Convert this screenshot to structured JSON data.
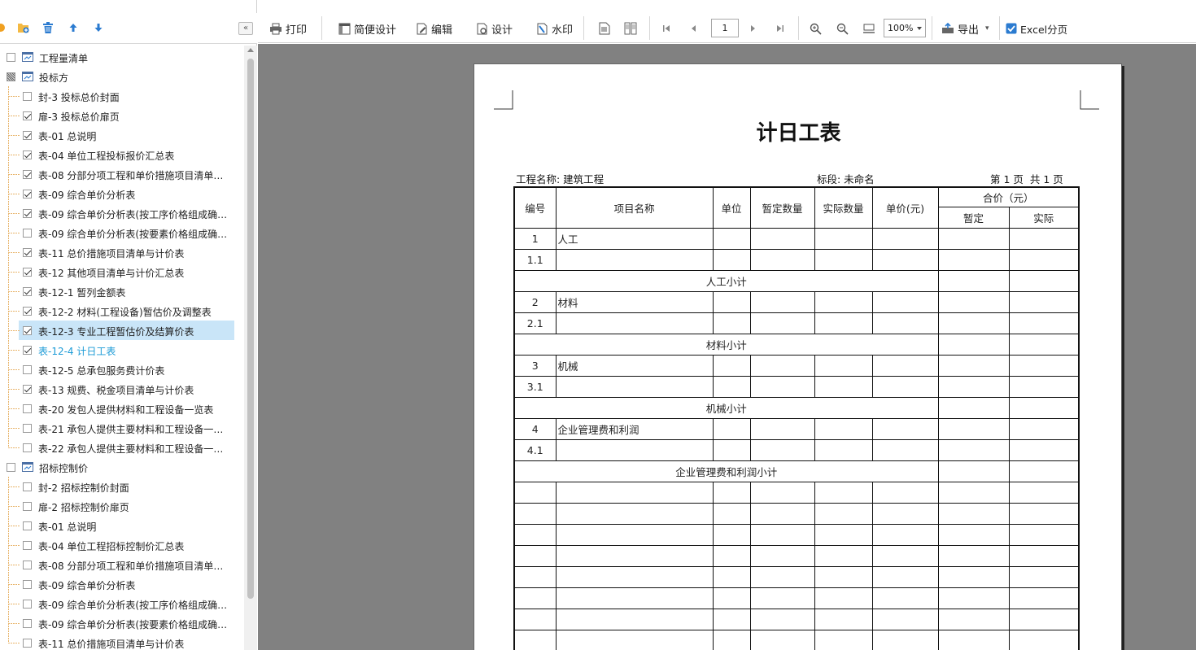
{
  "toolbar": {
    "print": "打印",
    "simple_design": "简便设计",
    "edit": "编辑",
    "design": "设计",
    "watermark": "水印",
    "page_value": "1",
    "zoom_value": "100%",
    "export": "导出",
    "excel_paging": "Excel分页"
  },
  "sidebar": {
    "collapse_label": "«",
    "tree": [
      {
        "label": "工程量清单",
        "level": 0,
        "check": "none"
      },
      {
        "label": "投标方",
        "level": 0,
        "check": "partial"
      },
      {
        "label": "封-3 投标总价封面",
        "level": 1,
        "check": "none"
      },
      {
        "label": "扉-3 投标总价扉页",
        "level": 1,
        "check": "checked"
      },
      {
        "label": "表-01 总说明",
        "level": 1,
        "check": "checked"
      },
      {
        "label": "表-04 单位工程投标报价汇总表",
        "level": 1,
        "check": "checked"
      },
      {
        "label": "表-08 分部分项工程和单价措施项目清单…",
        "level": 1,
        "check": "checked"
      },
      {
        "label": "表-09 综合单价分析表",
        "level": 1,
        "check": "checked"
      },
      {
        "label": "表-09 综合单价分析表(按工序价格组成确…",
        "level": 1,
        "check": "checked"
      },
      {
        "label": "表-09 综合单价分析表(按要素价格组成确…",
        "level": 1,
        "check": "none"
      },
      {
        "label": "表-11 总价措施项目清单与计价表",
        "level": 1,
        "check": "checked"
      },
      {
        "label": "表-12 其他项目清单与计价汇总表",
        "level": 1,
        "check": "checked"
      },
      {
        "label": "表-12-1 暂列金额表",
        "level": 1,
        "check": "checked"
      },
      {
        "label": "表-12-2 材料(工程设备)暂估价及调整表",
        "level": 1,
        "check": "checked"
      },
      {
        "label": "表-12-3 专业工程暂估价及结算价表",
        "level": 1,
        "check": "checked",
        "selected": true
      },
      {
        "label": "表-12-4 计日工表",
        "level": 1,
        "check": "checked",
        "current": true
      },
      {
        "label": "表-12-5 总承包服务费计价表",
        "level": 1,
        "check": "none"
      },
      {
        "label": "表-13 规费、税金项目清单与计价表",
        "level": 1,
        "check": "checked"
      },
      {
        "label": "表-20 发包人提供材料和工程设备一览表",
        "level": 1,
        "check": "none"
      },
      {
        "label": "表-21 承包人提供主要材料和工程设备一…",
        "level": 1,
        "check": "none"
      },
      {
        "label": "表-22 承包人提供主要材料和工程设备一…",
        "level": 1,
        "check": "none"
      },
      {
        "label": "招标控制价",
        "level": 0,
        "check": "none"
      },
      {
        "label": "封-2 招标控制价封面",
        "level": 1,
        "check": "none"
      },
      {
        "label": "扉-2 招标控制价扉页",
        "level": 1,
        "check": "none"
      },
      {
        "label": "表-01 总说明",
        "level": 1,
        "check": "none"
      },
      {
        "label": "表-04 单位工程招标控制价汇总表",
        "level": 1,
        "check": "none"
      },
      {
        "label": "表-08 分部分项工程和单价措施项目清单…",
        "level": 1,
        "check": "none"
      },
      {
        "label": "表-09 综合单价分析表",
        "level": 1,
        "check": "none"
      },
      {
        "label": "表-09 综合单价分析表(按工序价格组成确…",
        "level": 1,
        "check": "none"
      },
      {
        "label": "表-09 综合单价分析表(按要素价格组成确…",
        "level": 1,
        "check": "none"
      },
      {
        "label": "表-11 总价措施项目清单与计价表",
        "level": 1,
        "check": "none"
      }
    ]
  },
  "report": {
    "title": "计日工表",
    "project_name": "工程名称: 建筑工程",
    "section": "标段: 未命名",
    "page_info": "第 1 页  共 1 页",
    "headers": {
      "no": "编号",
      "name": "项目名称",
      "unit": "单位",
      "est_qty": "暂定数量",
      "actual_qty": "实际数量",
      "unit_price": "单价(元)",
      "total": "合价（元）",
      "total_est": "暂定",
      "total_actual": "实际"
    },
    "rows": [
      {
        "type": "item",
        "no": "1",
        "name": "人工"
      },
      {
        "type": "item",
        "no": "1.1",
        "name": ""
      },
      {
        "type": "subtotal",
        "label": "人工小计"
      },
      {
        "type": "item",
        "no": "2",
        "name": "材料"
      },
      {
        "type": "item",
        "no": "2.1",
        "name": ""
      },
      {
        "type": "subtotal",
        "label": "材料小计"
      },
      {
        "type": "item",
        "no": "3",
        "name": "机械"
      },
      {
        "type": "item",
        "no": "3.1",
        "name": ""
      },
      {
        "type": "subtotal",
        "label": "机械小计"
      },
      {
        "type": "item",
        "no": "4",
        "name": "企业管理费和利润"
      },
      {
        "type": "item",
        "no": "4.1",
        "name": ""
      },
      {
        "type": "subtotal",
        "label": "企业管理费和利润小计"
      },
      {
        "type": "item",
        "no": "",
        "name": ""
      },
      {
        "type": "item",
        "no": "",
        "name": ""
      },
      {
        "type": "item",
        "no": "",
        "name": ""
      },
      {
        "type": "item",
        "no": "",
        "name": ""
      },
      {
        "type": "item",
        "no": "",
        "name": ""
      },
      {
        "type": "item",
        "no": "",
        "name": ""
      },
      {
        "type": "item",
        "no": "",
        "name": ""
      },
      {
        "type": "item",
        "no": "",
        "name": ""
      }
    ]
  }
}
